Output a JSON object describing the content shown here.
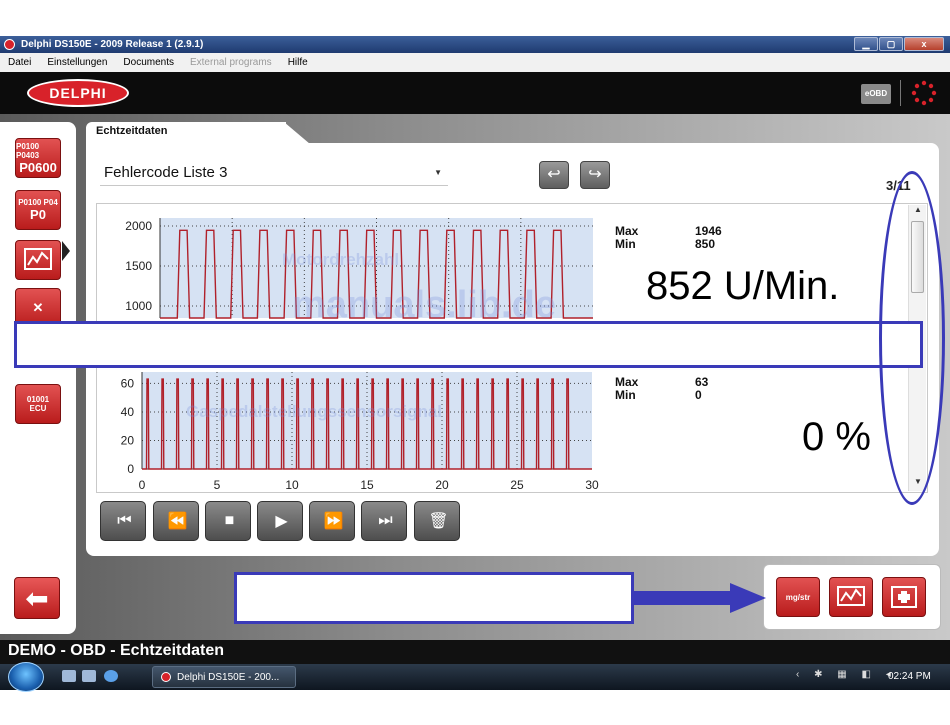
{
  "window": {
    "title": "Delphi DS150E - 2009 Release 1 (2.9.1)",
    "buttons": {
      "minimize": "▁",
      "maximize": "▢",
      "close": "x"
    }
  },
  "menu": [
    {
      "label": "Datei",
      "enabled": true
    },
    {
      "label": "Einstellungen",
      "enabled": true
    },
    {
      "label": "Documents",
      "enabled": true
    },
    {
      "label": "External programs",
      "enabled": false
    },
    {
      "label": "Hilfe",
      "enabled": true
    }
  ],
  "brand": {
    "logo_text": "DELPHI",
    "badge": "eOBD"
  },
  "sidebar": [
    {
      "label": "P0100 P0403",
      "big": "P0600",
      "icon": "dtc-read-icon"
    },
    {
      "label": "P0100 P04",
      "big": "P0",
      "icon": "dtc-clear-icon"
    },
    {
      "label": "",
      "big": "",
      "icon": "live-data-icon"
    },
    {
      "label": "",
      "big": "✕",
      "icon": "tools-icon"
    },
    {
      "label": "01001",
      "big": "ECU",
      "icon": "ecu-info-icon"
    }
  ],
  "tab": {
    "label": "Echtzeitdaten"
  },
  "list": {
    "selected": "Fehlercode Liste 3"
  },
  "nav": {
    "prev": "↩",
    "next": "↪"
  },
  "page_counter": "3/11",
  "readouts": [
    {
      "max_label": "Max",
      "max_value": "1946",
      "min_label": "Min",
      "min_value": "850",
      "current": "852 U/Min."
    },
    {
      "max_label": "Max",
      "max_value": "63",
      "min_label": "Min",
      "min_value": "0",
      "current": "0 %"
    }
  ],
  "watermarks": {
    "series1": "Motordrehzahl",
    "series2": "Gaspedalstellungssensorsignal",
    "site": "manuals.lib.de"
  },
  "playback": [
    {
      "name": "first-button",
      "glyph": "⏮",
      "icon": "skip-start-icon"
    },
    {
      "name": "rewind-button",
      "glyph": "⏪",
      "icon": "rewind-icon"
    },
    {
      "name": "stop-button",
      "glyph": "■",
      "icon": "stop-icon"
    },
    {
      "name": "play-button",
      "glyph": "▶",
      "icon": "play-icon"
    },
    {
      "name": "fast-forward-button",
      "glyph": "⏩",
      "icon": "fast-forward-icon"
    },
    {
      "name": "last-button",
      "glyph": "⏭",
      "icon": "skip-end-icon"
    },
    {
      "name": "delete-button",
      "glyph": "🗑",
      "icon": "trash-icon"
    }
  ],
  "mode_buttons": [
    {
      "label": "mg/str",
      "icon": "units-icon"
    },
    {
      "label": "",
      "icon": "graph-mode-icon"
    },
    {
      "label": "",
      "icon": "freeze-frame-icon"
    }
  ],
  "status": {
    "text": "DEMO - OBD - Echtzeitdaten"
  },
  "taskbar": {
    "app": "Delphi DS150E - 200...",
    "clock": "02:24 PM"
  },
  "colors": {
    "brand_red": "#d8222a",
    "trace": "#b0202a",
    "plot_bg": "#d6e2f3",
    "annotation": "#3a3ab8"
  },
  "chart_data": [
    {
      "type": "line",
      "title": "",
      "xlabel": "",
      "ylabel": "",
      "x_ticks": [],
      "y_ticks": [
        2000,
        1500,
        1000
      ],
      "ylim": [
        850,
        2100
      ],
      "xlim": [
        0,
        30
      ],
      "pulses": {
        "count": 15,
        "low": 850,
        "high": 1946,
        "start": 1.2,
        "period": 1.85,
        "width": 0.85
      },
      "grid": true
    },
    {
      "type": "line",
      "title": "",
      "xlabel": "",
      "ylabel": "",
      "x_ticks": [
        0,
        5,
        10,
        15,
        20,
        25,
        30
      ],
      "y_ticks": [
        60,
        40,
        20,
        0
      ],
      "ylim": [
        0,
        68
      ],
      "xlim": [
        0,
        30
      ],
      "pulses": {
        "count": 29,
        "low": 0,
        "high": 63,
        "start": 0.3,
        "period": 1.0,
        "width": 0.15
      },
      "grid": true
    }
  ]
}
